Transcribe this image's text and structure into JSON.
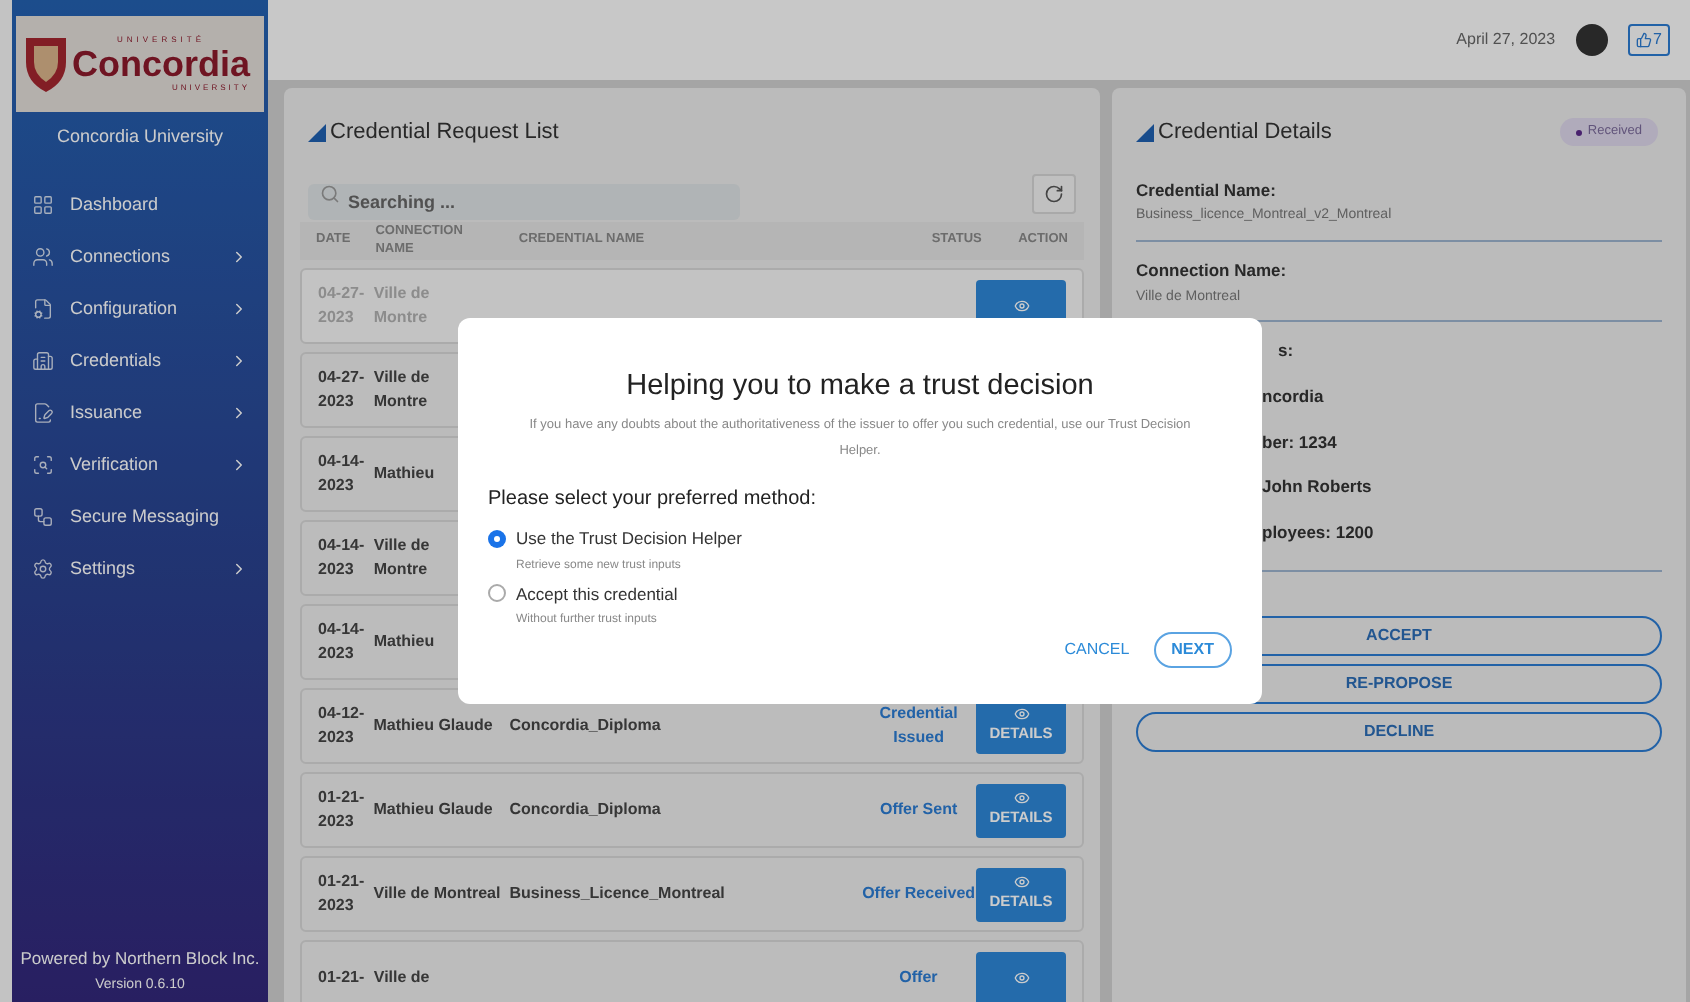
{
  "logo": {
    "top": "UNIVERSITÉ",
    "name": "Concordia",
    "bottom": "UNIVERSITY"
  },
  "sidebar": {
    "org": "Concordia University",
    "items": [
      {
        "label": "Dashboard",
        "has_submenu": false
      },
      {
        "label": "Connections",
        "has_submenu": true
      },
      {
        "label": "Configuration",
        "has_submenu": true
      },
      {
        "label": "Credentials",
        "has_submenu": true
      },
      {
        "label": "Issuance",
        "has_submenu": true
      },
      {
        "label": "Verification",
        "has_submenu": true
      },
      {
        "label": "Secure Messaging",
        "has_submenu": false
      },
      {
        "label": "Settings",
        "has_submenu": true
      }
    ],
    "footer": "Powered by Northern Block Inc.",
    "version": "Version 0.6.10"
  },
  "top_bar": {
    "date": "April 27, 2023",
    "badge_count": "7"
  },
  "request_list": {
    "title": "Credential Request List",
    "search": {
      "placeholder": "Searching ..."
    },
    "columns": [
      "DATE",
      "CONNECTION NAME",
      "CREDENTIAL NAME",
      "STATUS",
      "ACTION"
    ],
    "rows": [
      {
        "date": "04-27-2023",
        "connection": "Ville de Montre",
        "selected": true
      },
      {
        "date": "04-27-2023",
        "connection": "Ville de Montre",
        "selected": false
      },
      {
        "date": "04-14-2023",
        "connection": "Mathieu",
        "selected": false
      },
      {
        "date": "04-14-2023",
        "connection": "Ville de Montre",
        "selected": false
      },
      {
        "date": "04-14-2023",
        "connection": "Mathieu",
        "selected": false
      },
      {
        "date": "04-12-2023",
        "connection": "Mathieu Glaude",
        "credential": "Concordia_Diploma",
        "status": "Credential Issued",
        "action": "DETAILS",
        "selected": false
      },
      {
        "date": "01-21-2023",
        "connection": "Mathieu Glaude",
        "credential": "Concordia_Diploma",
        "status": "Offer Sent",
        "action": "DETAILS",
        "selected": false
      },
      {
        "date": "01-21-2023",
        "connection": "Ville de Montreal",
        "credential": "Business_Licence_Montreal",
        "status": "Offer Received",
        "action": "DETAILS",
        "selected": false
      },
      {
        "date": "01-21-",
        "connection": "Ville de",
        "status": "Offer",
        "selected": false
      }
    ]
  },
  "details": {
    "title": "Credential Details",
    "status": "Received",
    "fields": [
      {
        "label": "Credential Name:",
        "value": "Business_licence_Montreal_v2_Montreal"
      },
      {
        "label": "Connection Name:",
        "value": "Ville de Montreal"
      }
    ],
    "attributes_label": "s:",
    "attributes": [
      "ncordia",
      "ber: 1234",
      "John Roberts",
      "ployees: 1200"
    ],
    "buttons": [
      "ACCEPT",
      "RE-PROPOSE",
      "DECLINE"
    ]
  },
  "dialog": {
    "title": "Helping you to make a trust decision",
    "description": "If you have any doubts about the authoritativeness of the issuer to offer you such credential, use our Trust Decision Helper.",
    "question": "Please select your preferred method:",
    "options": [
      {
        "label": "Use the Trust Decision Helper",
        "hint": "Retrieve some new trust inputs",
        "selected": true
      },
      {
        "label": "Accept this credential",
        "hint": "Without further trust inputs",
        "selected": false
      }
    ],
    "buttons": [
      {
        "label": "CANCEL",
        "kind": "text"
      },
      {
        "label": "NEXT",
        "kind": "outlined"
      }
    ]
  }
}
